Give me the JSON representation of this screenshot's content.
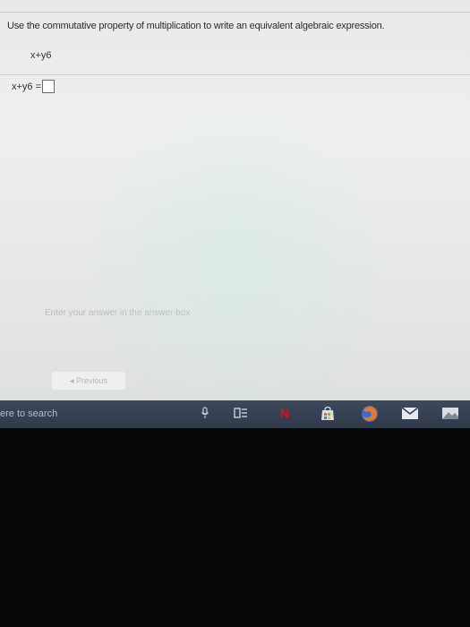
{
  "question": {
    "instruction": "Use the commutative property of multiplication to write an equivalent algebraic expression.",
    "given_expression": "x+y6",
    "answer_prefix": "x+y6 ="
  },
  "hint": "Enter your answer in the answer box",
  "nav": {
    "previous_label": "◂ Previous"
  },
  "taskbar": {
    "search_text": "ere to search",
    "icons": [
      "microphone-icon",
      "task-view-icon",
      "netflix-icon",
      "store-icon",
      "firefox-icon",
      "mail-icon",
      "photos-icon"
    ],
    "netflix_letter": "N"
  },
  "colors": {
    "netflix": "#e50914",
    "firefox": "#e9742b",
    "taskbar": "#34404f"
  }
}
